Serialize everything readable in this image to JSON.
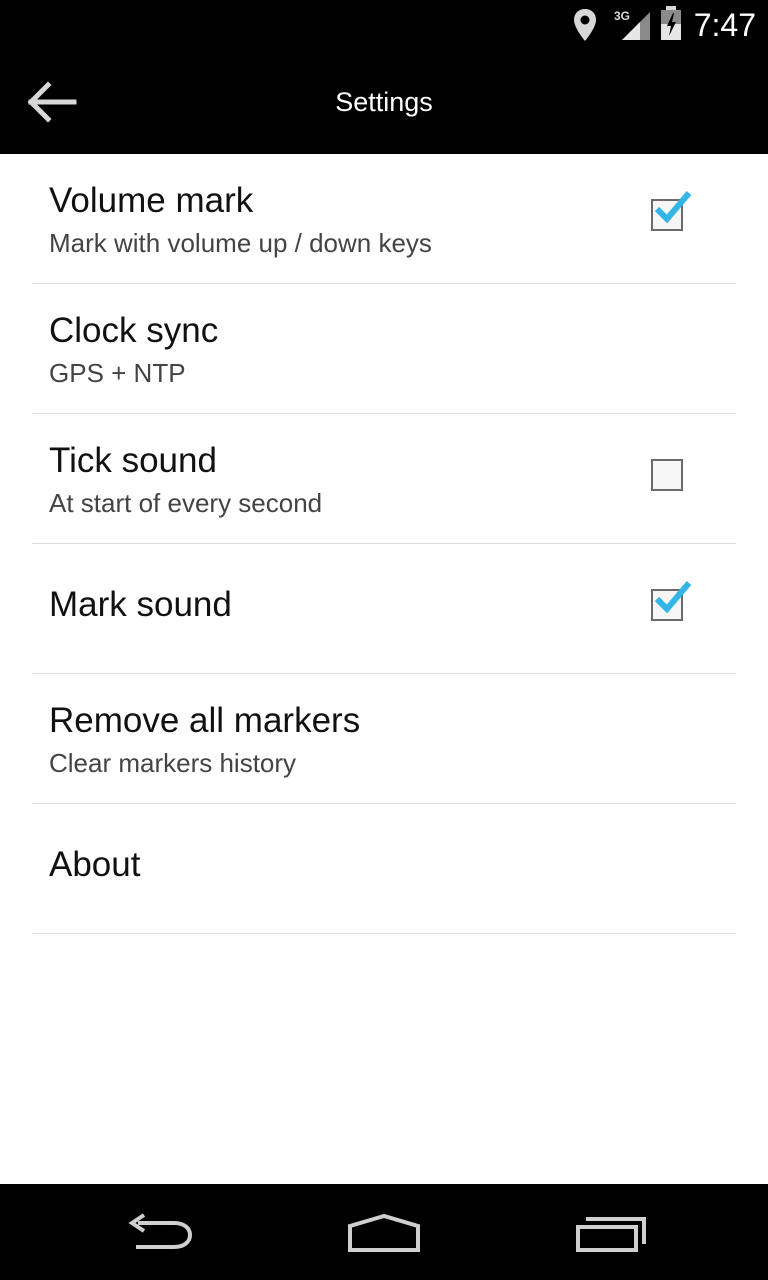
{
  "status_bar": {
    "time": "7:47",
    "network_label": "3G",
    "icons": [
      "location-icon",
      "signal-3g-icon",
      "battery-icon"
    ]
  },
  "action_bar": {
    "title": "Settings",
    "back_icon": "back-arrow-icon"
  },
  "settings": [
    {
      "title": "Volume mark",
      "summary": "Mark with volume up / down keys",
      "checkbox": true,
      "checked": true
    },
    {
      "title": "Clock sync",
      "summary": "GPS + NTP",
      "checkbox": false
    },
    {
      "title": "Tick sound",
      "summary": "At start of every second",
      "checkbox": true,
      "checked": false
    },
    {
      "title": "Mark sound",
      "summary": "",
      "checkbox": true,
      "checked": true
    },
    {
      "title": "Remove all markers",
      "summary": "Clear markers history",
      "checkbox": false
    },
    {
      "title": "About",
      "summary": "",
      "checkbox": false
    }
  ],
  "nav_bar": {
    "buttons": [
      "back-icon",
      "home-icon",
      "recent-apps-icon"
    ]
  },
  "colors": {
    "check_accent": "#33b5e5",
    "bar_background": "#000000",
    "divider": "#dddddd"
  }
}
